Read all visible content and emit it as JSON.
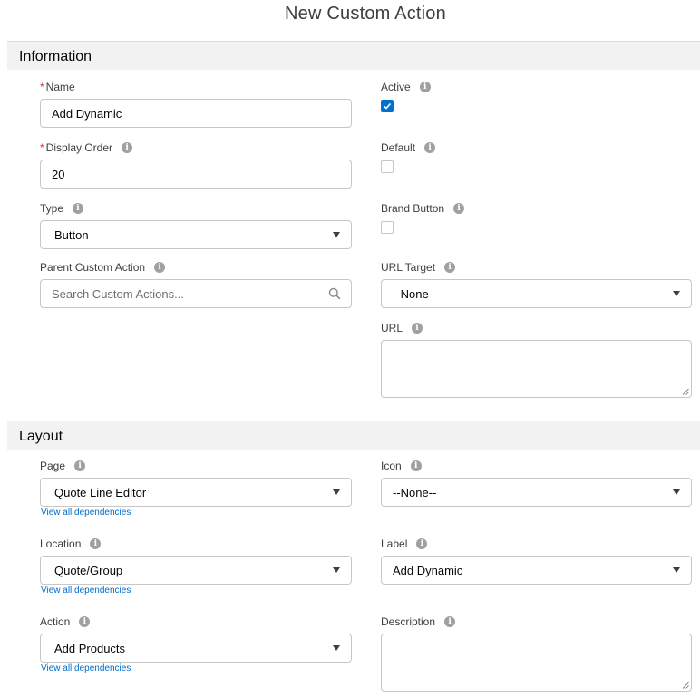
{
  "page": {
    "title": "New Custom Action"
  },
  "information": {
    "header": "Information",
    "name": {
      "label": "Name",
      "required": "*",
      "value": "Add Dynamic"
    },
    "display_order": {
      "label": "Display Order",
      "required": "*",
      "value": "20"
    },
    "type": {
      "label": "Type",
      "value": "Button"
    },
    "parent_custom_action": {
      "label": "Parent Custom Action",
      "placeholder": "Search Custom Actions..."
    },
    "active": {
      "label": "Active",
      "checked": true
    },
    "default": {
      "label": "Default",
      "checked": false
    },
    "brand_button": {
      "label": "Brand Button",
      "checked": false
    },
    "url_target": {
      "label": "URL Target",
      "value": "--None--"
    },
    "url": {
      "label": "URL",
      "value": ""
    }
  },
  "layout": {
    "header": "Layout",
    "page": {
      "label": "Page",
      "value": "Quote Line Editor",
      "link": "View all dependencies"
    },
    "location": {
      "label": "Location",
      "value": "Quote/Group",
      "link": "View all dependencies"
    },
    "action": {
      "label": "Action",
      "value": "Add Products",
      "link": "View all dependencies"
    },
    "icon": {
      "label": "Icon",
      "value": "--None--"
    },
    "label": {
      "label": "Label",
      "value": "Add Dynamic"
    },
    "description": {
      "label": "Description",
      "value": ""
    }
  },
  "icons": {
    "info": "info-icon",
    "info_glyph": "i",
    "dropdown": "chevron-down-icon",
    "search": "search-icon",
    "check": "check-icon"
  },
  "colors": {
    "accent": "#0070d2",
    "required": "#c23934",
    "link": "#006dcc",
    "section_bg": "#f3f2f2"
  }
}
